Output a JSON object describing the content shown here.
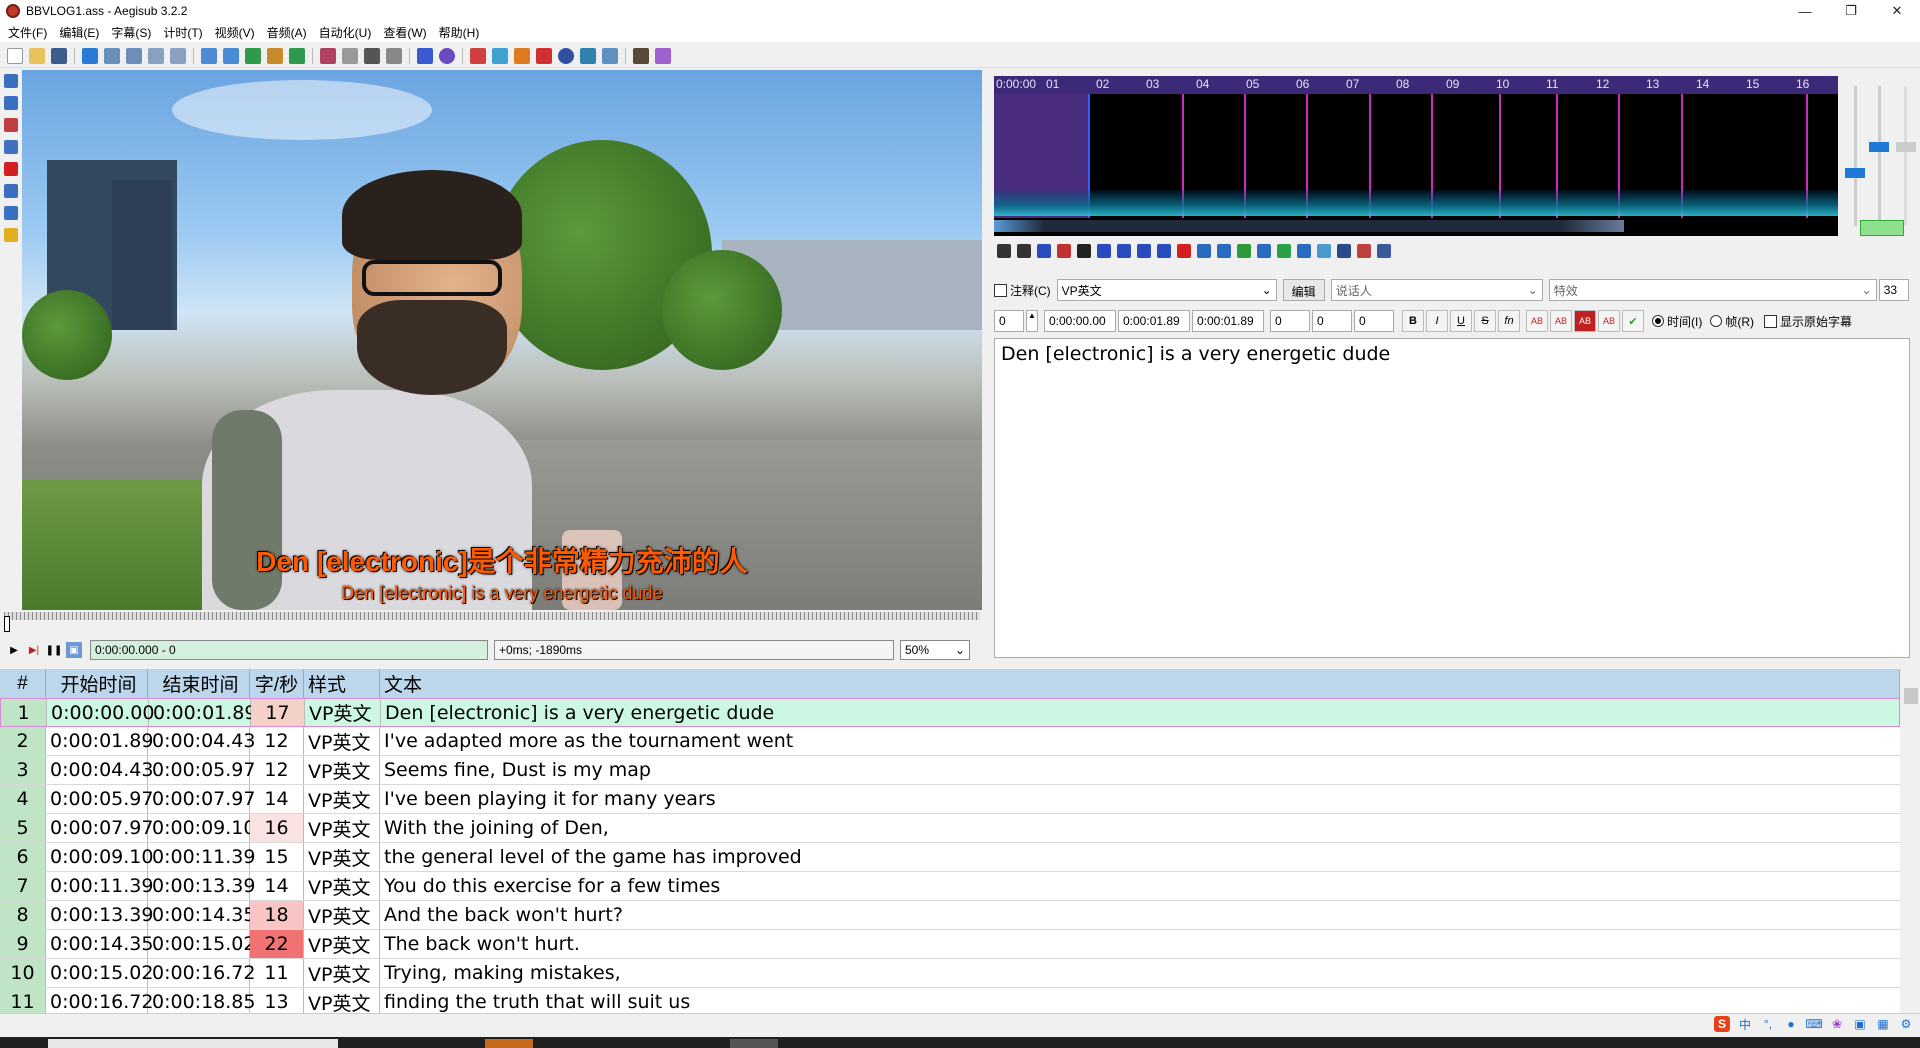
{
  "window": {
    "title": "BBVLOG1.ass - Aegisub 3.2.2"
  },
  "menu": [
    "文件(F)",
    "编辑(E)",
    "字幕(S)",
    "计时(T)",
    "视频(V)",
    "音频(A)",
    "自动化(U)",
    "查看(W)",
    "帮助(H)"
  ],
  "video": {
    "subtitle_cn": "Den [electronic]是个非常精力充沛的人",
    "subtitle_en": "Den [electronic] is a very energetic dude",
    "time_display": "0:00:00.000 - 0",
    "offset_display": "+0ms; -1890ms",
    "zoom": "50%"
  },
  "audio": {
    "ruler": [
      "0:00:00",
      "01",
      "02",
      "03",
      "04",
      "05",
      "06",
      "07",
      "08",
      "09",
      "10",
      "11",
      "12",
      "13",
      "14",
      "15",
      "16"
    ]
  },
  "edit": {
    "comment_label": "注释(C)",
    "style": "VP英文",
    "edit_button": "编辑",
    "actor_placeholder": "说话人",
    "effect_placeholder": "特效",
    "char_count": "33",
    "layer": "0",
    "start_time": "0:00:00.00",
    "end_time": "0:00:01.89",
    "duration": "0:00:01.89",
    "margin_l": "0",
    "margin_r": "0",
    "margin_v": "0",
    "radio_time": "时间(I)",
    "radio_frame": "帧(R)",
    "show_original": "显示原始字幕",
    "text": "Den [electronic] is a very energetic dude",
    "format_buttons": [
      "B",
      "I",
      "U",
      "S",
      "fn",
      "AB",
      "AB",
      "AB",
      "AB"
    ]
  },
  "grid": {
    "headers": {
      "num": "#",
      "start": "开始时间",
      "end": "结束时间",
      "cps": "字/秒",
      "style": "样式",
      "text": "文本"
    },
    "rows": [
      {
        "num": "1",
        "start": "0:00:00.00",
        "end": "0:00:01.89",
        "cps": "17",
        "style": "VP英文",
        "text": "Den [electronic] is a very energetic dude",
        "cps_color": "#f3d0c8"
      },
      {
        "num": "2",
        "start": "0:00:01.89",
        "end": "0:00:04.43",
        "cps": "12",
        "style": "VP英文",
        "text": "I've adapted more as the tournament went",
        "cps_color": ""
      },
      {
        "num": "3",
        "start": "0:00:04.43",
        "end": "0:00:05.97",
        "cps": "12",
        "style": "VP英文",
        "text": "Seems fine, Dust is my map",
        "cps_color": ""
      },
      {
        "num": "4",
        "start": "0:00:05.97",
        "end": "0:00:07.97",
        "cps": "14",
        "style": "VP英文",
        "text": "I've been playing it for many years",
        "cps_color": ""
      },
      {
        "num": "5",
        "start": "0:00:07.97",
        "end": "0:00:09.10",
        "cps": "16",
        "style": "VP英文",
        "text": "With the joining of Den,",
        "cps_color": "#fbe2e2"
      },
      {
        "num": "6",
        "start": "0:00:09.10",
        "end": "0:00:11.39",
        "cps": "15",
        "style": "VP英文",
        "text": "the general level of the game has improved",
        "cps_color": ""
      },
      {
        "num": "7",
        "start": "0:00:11.39",
        "end": "0:00:13.39",
        "cps": "14",
        "style": "VP英文",
        "text": "You do this exercise for a few times",
        "cps_color": ""
      },
      {
        "num": "8",
        "start": "0:00:13.39",
        "end": "0:00:14.35",
        "cps": "18",
        "style": "VP英文",
        "text": "And the back won't hurt?",
        "cps_color": "#f8c4c4"
      },
      {
        "num": "9",
        "start": "0:00:14.35",
        "end": "0:00:15.02",
        "cps": "22",
        "style": "VP英文",
        "text": "The back won't hurt.",
        "cps_color": "#f07272"
      },
      {
        "num": "10",
        "start": "0:00:15.02",
        "end": "0:00:16.72",
        "cps": "11",
        "style": "VP英文",
        "text": "Trying, making mistakes,",
        "cps_color": ""
      },
      {
        "num": "11",
        "start": "0:00:16.72",
        "end": "0:00:18.85",
        "cps": "13",
        "style": "VP英文",
        "text": "finding the truth that will suit us",
        "cps_color": ""
      }
    ]
  },
  "ime": {
    "lang": "中"
  }
}
